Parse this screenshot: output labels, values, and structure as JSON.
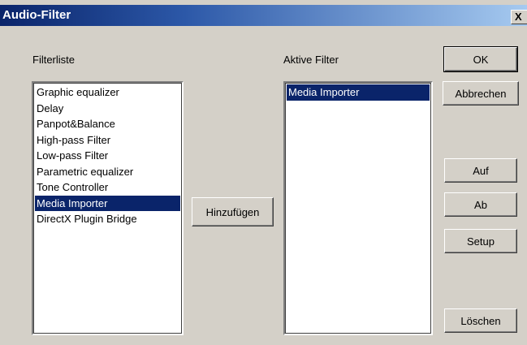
{
  "window": {
    "title": "Audio-Filter",
    "close_label": "X"
  },
  "filterliste": {
    "label": "Filterliste",
    "items": [
      "Graphic equalizer",
      "Delay",
      "Panpot&Balance",
      "High-pass Filter",
      "Low-pass Filter",
      "Parametric equalizer",
      "Tone Controller",
      "Media Importer",
      "DirectX Plugin Bridge"
    ],
    "selected": "Media Importer"
  },
  "aktive_filter": {
    "label": "Aktive Filter",
    "items": [
      "Media Importer"
    ],
    "selected": "Media Importer"
  },
  "buttons": {
    "hinzufuegen": "Hinzufügen",
    "ok": "OK",
    "abbrechen": "Abbrechen",
    "auf": "Auf",
    "ab": "Ab",
    "setup": "Setup",
    "loeschen": "Löschen"
  },
  "colors": {
    "dialog_bg": "#d4d0c8",
    "selection_bg": "#0a246a",
    "titlebar_start": "#0a246a",
    "titlebar_end": "#a6caf0"
  }
}
